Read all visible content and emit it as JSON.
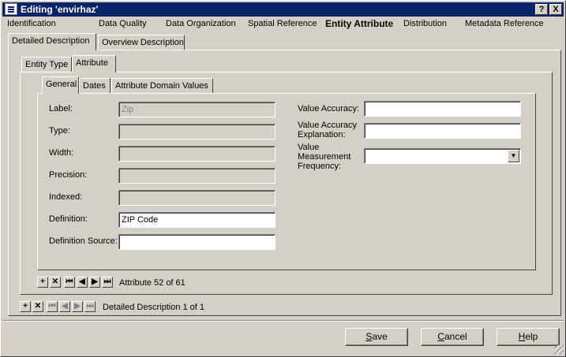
{
  "window": {
    "title": "Editing 'envirhaz'",
    "help_btn": "?",
    "close_btn": "X"
  },
  "topnav": [
    "Identification",
    "Data Quality",
    "Data Organization",
    "Spatial Reference",
    "Entity Attribute",
    "Distribution",
    "Metadata Reference"
  ],
  "level1_tabs": [
    "Detailed Description",
    "Overview Description"
  ],
  "level2_tabs": [
    "Entity Type",
    "Attribute"
  ],
  "level3_tabs": [
    "General",
    "Dates",
    "Attribute Domain Values"
  ],
  "form": {
    "label_lbl": "Label:",
    "label_val": "Zip",
    "type_lbl": "Type:",
    "type_val": "",
    "width_lbl": "Width:",
    "width_val": "",
    "precision_lbl": "Precision:",
    "precision_val": "",
    "indexed_lbl": "Indexed:",
    "indexed_val": "",
    "definition_lbl": "Definition:",
    "definition_val": "ZIP Code",
    "defsource_lbl": "Definition Source:",
    "defsource_val": "",
    "va_lbl": "Value Accuracy:",
    "va_val": "",
    "vae_lbl1": "Value Accuracy",
    "vae_lbl2": "Explanation:",
    "vae_val": "",
    "vmf_lbl1": "Value",
    "vmf_lbl2": "Measurement",
    "vmf_lbl3": "Frequency:",
    "vmf_val": ""
  },
  "attr_nav": {
    "add": "+",
    "del": "✕",
    "first": "⏮",
    "prev": "◀",
    "next": "▶",
    "last": "⏭",
    "status": "Attribute 52 of 61"
  },
  "dd_nav": {
    "add": "+",
    "del": "✕",
    "first": "⏮",
    "prev": "◀",
    "next": "▶",
    "last": "⏭",
    "status": "Detailed Description 1 of 1"
  },
  "buttons": {
    "save_u": "S",
    "save_rest": "ave",
    "cancel_u": "C",
    "cancel_rest": "ancel",
    "help_u": "H",
    "help_rest": "elp"
  }
}
